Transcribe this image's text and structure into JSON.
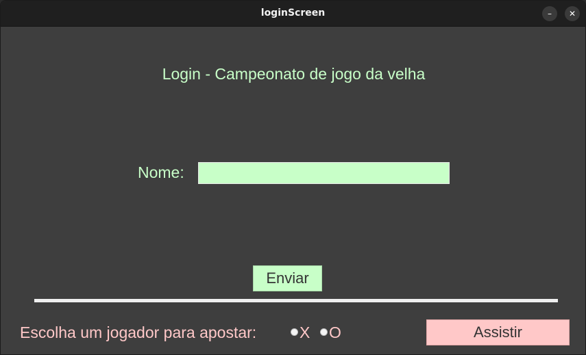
{
  "window": {
    "title": "loginScreen",
    "minimize_glyph": "–",
    "close_glyph": "✕"
  },
  "login": {
    "heading": "Login - Campeonato de jogo da velha",
    "name_label": "Nome:",
    "name_value": "",
    "send_label": "Enviar"
  },
  "bet": {
    "label": "Escolha um jogador para apostar:",
    "options": [
      {
        "label": "X",
        "selected": false
      },
      {
        "label": "O",
        "selected": false
      }
    ],
    "watch_label": "Assistir"
  },
  "colors": {
    "background": "#3e3e3e",
    "green_accent": "#c8ffc8",
    "pink_accent": "#ffc8c8",
    "divider": "#f0f0f0"
  }
}
